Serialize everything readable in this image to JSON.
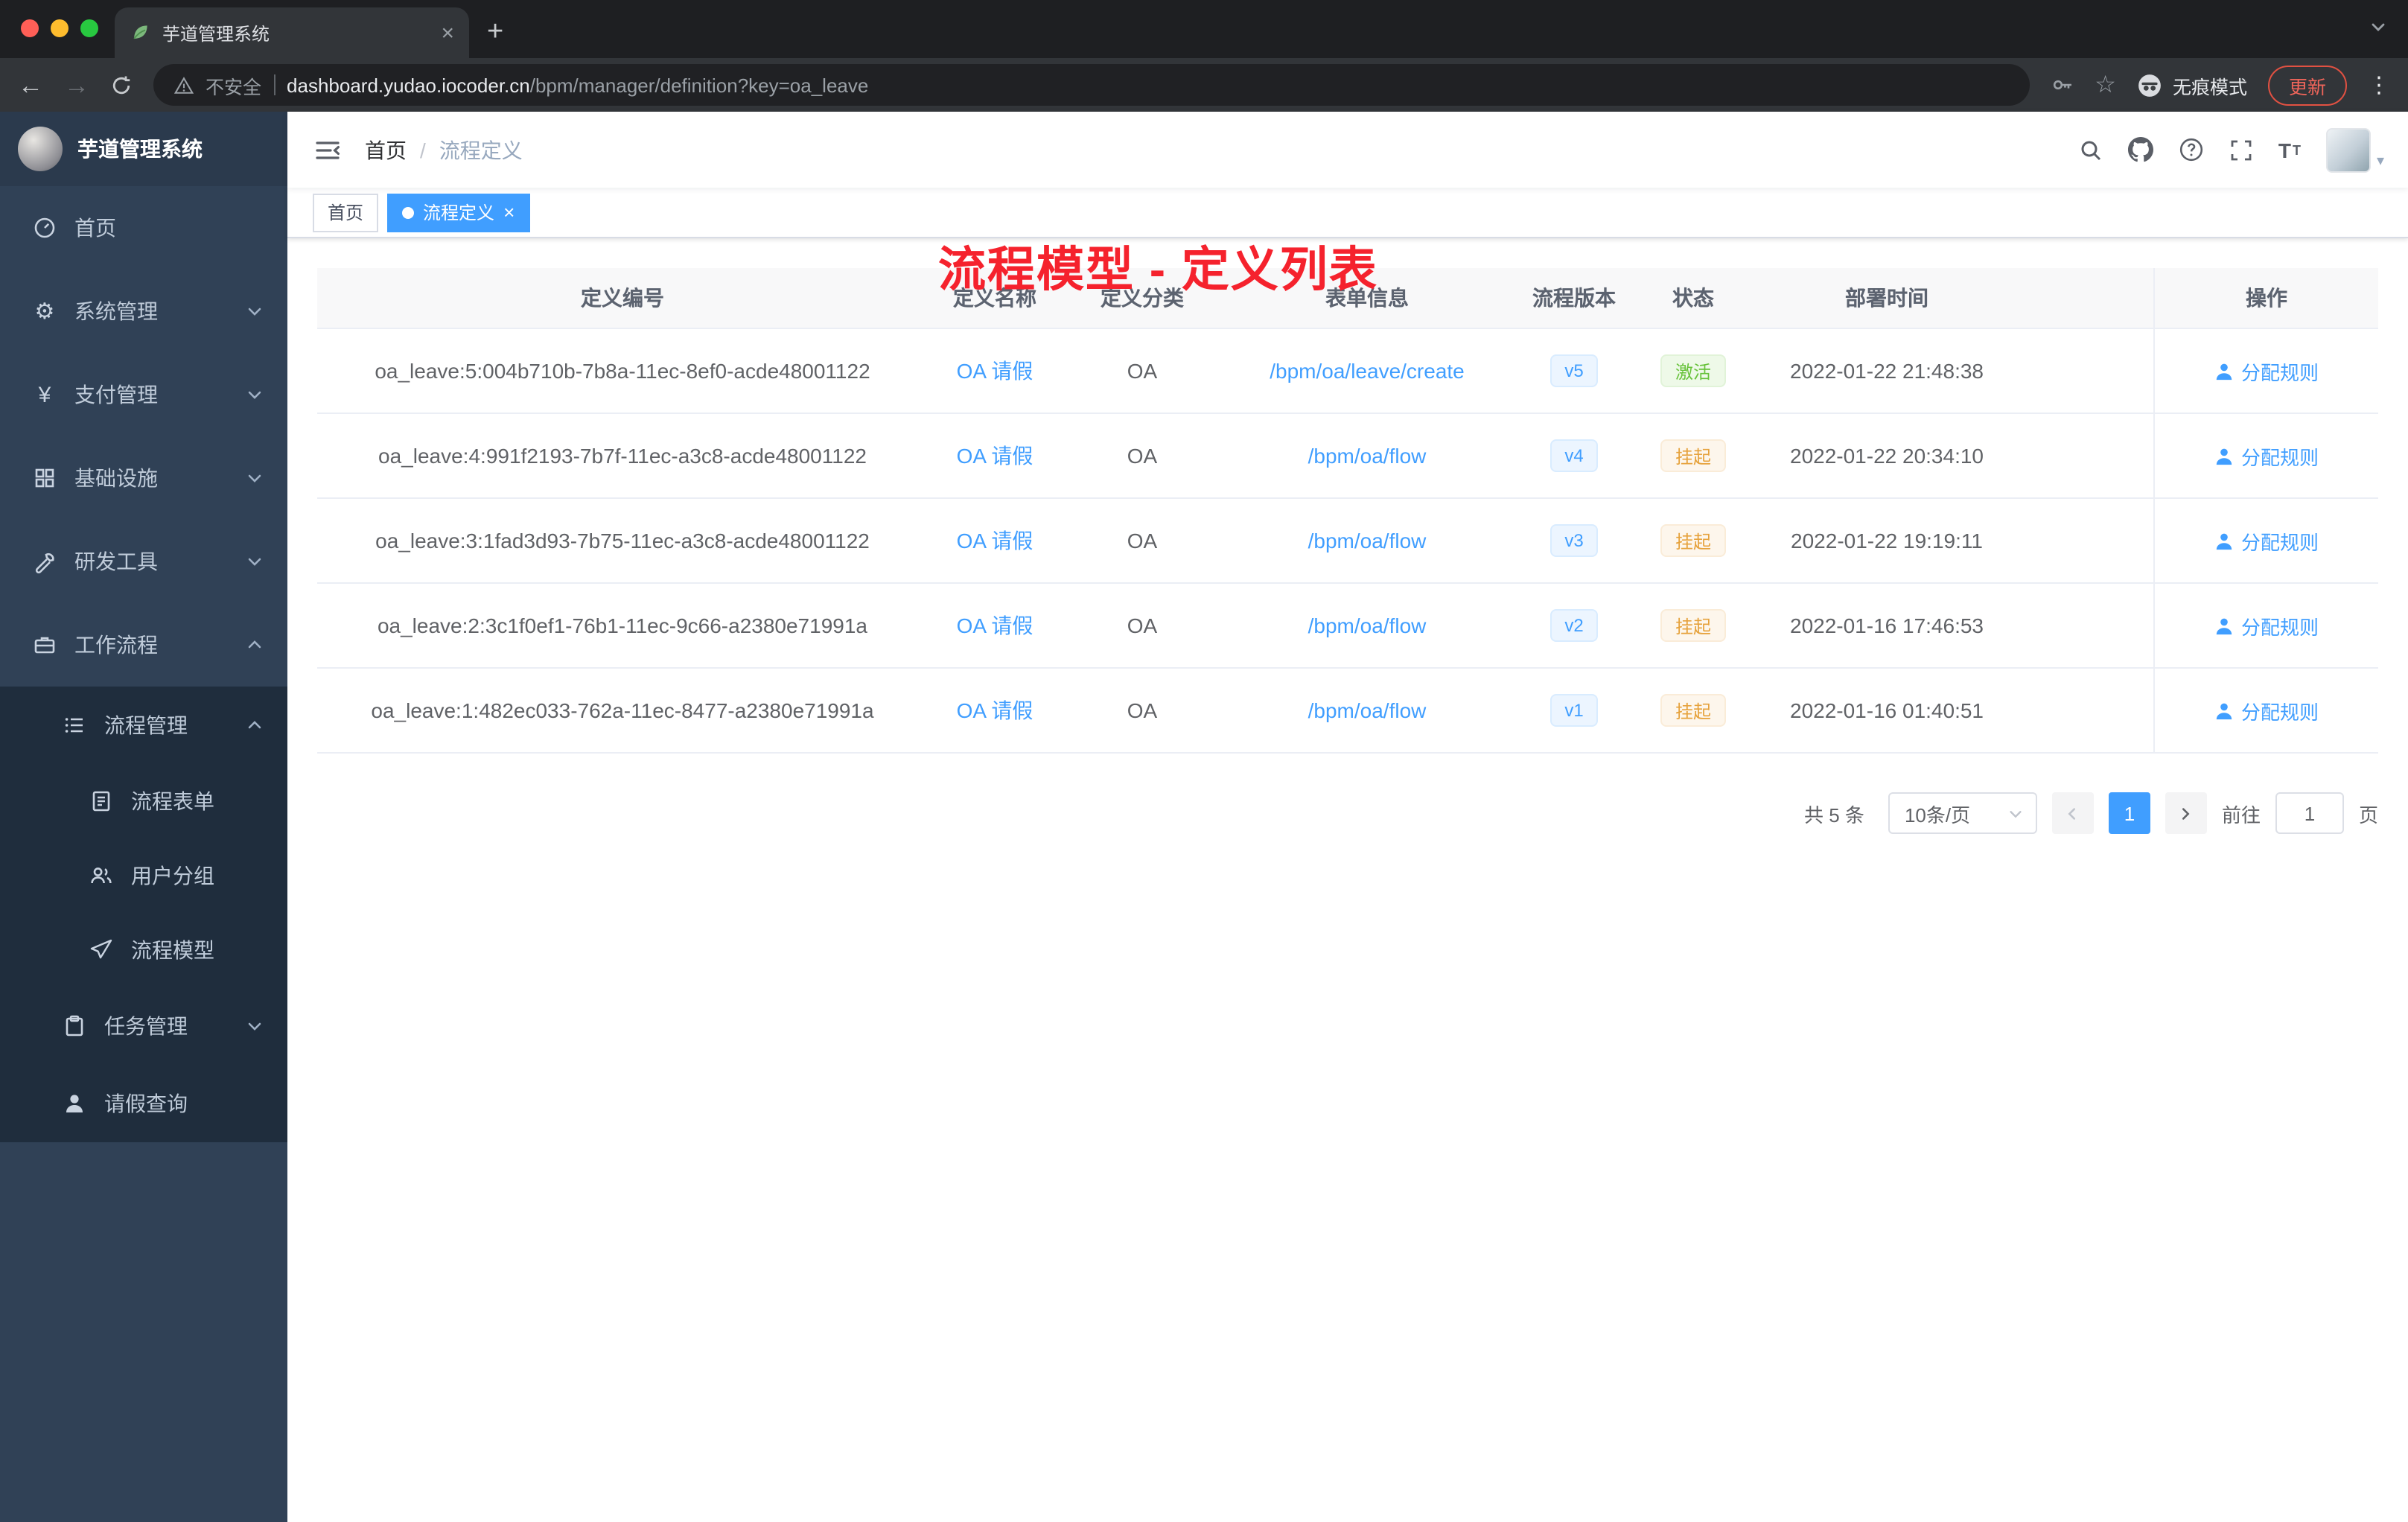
{
  "colors": {
    "accent": "#409eff",
    "success": "#67c23a",
    "warning": "#e6a23c",
    "annotation_red": "#f5222d",
    "sidebar_bg": "#304156",
    "submenu_bg": "#1f2d3d"
  },
  "icons": {
    "close": "×",
    "plus": "+",
    "back": "←",
    "forward": "→",
    "star": "☆",
    "more_vertical": "⋮",
    "caret_down": "▾",
    "gear": "⚙",
    "yen": "¥",
    "font_size_big": "T",
    "font_size_small": "T"
  },
  "browser": {
    "tab_title": "芋道管理系统",
    "not_secure": "不安全",
    "url_host": "dashboard.yudao.iocoder.cn",
    "url_path": "/bpm/manager/definition?key=oa_leave",
    "incognito_label": "无痕模式",
    "update_label": "更新"
  },
  "sidebar": {
    "logo_title": "芋道管理系统",
    "items": [
      {
        "label": "首页"
      },
      {
        "label": "系统管理"
      },
      {
        "label": "支付管理"
      },
      {
        "label": "基础设施"
      },
      {
        "label": "研发工具"
      },
      {
        "label": "工作流程"
      },
      {
        "label": "流程管理"
      },
      {
        "label": "流程表单"
      },
      {
        "label": "用户分组"
      },
      {
        "label": "流程模型"
      },
      {
        "label": "任务管理"
      },
      {
        "label": "请假查询"
      }
    ]
  },
  "header": {
    "breadcrumb_home": "首页",
    "breadcrumb_sep": "/",
    "breadcrumb_current": "流程定义",
    "annotation": "流程模型 - 定义列表"
  },
  "tags": {
    "home": "首页",
    "active": "流程定义"
  },
  "table": {
    "columns": [
      "定义编号",
      "定义名称",
      "定义分类",
      "表单信息",
      "流程版本",
      "状态",
      "部署时间",
      "操作"
    ],
    "rows": [
      {
        "id": "oa_leave:5:004b710b-7b8a-11ec-8ef0-acde48001122",
        "name": "OA 请假",
        "category": "OA",
        "form": "/bpm/oa/leave/create",
        "version": "v5",
        "status": "激活",
        "time": "2022-01-22 21:48:38",
        "action": "分配规则"
      },
      {
        "id": "oa_leave:4:991f2193-7b7f-11ec-a3c8-acde48001122",
        "name": "OA 请假",
        "category": "OA",
        "form": "/bpm/oa/flow",
        "version": "v4",
        "status": "挂起",
        "time": "2022-01-22 20:34:10",
        "action": "分配规则"
      },
      {
        "id": "oa_leave:3:1fad3d93-7b75-11ec-a3c8-acde48001122",
        "name": "OA 请假",
        "category": "OA",
        "form": "/bpm/oa/flow",
        "version": "v3",
        "status": "挂起",
        "time": "2022-01-22 19:19:11",
        "action": "分配规则"
      },
      {
        "id": "oa_leave:2:3c1f0ef1-76b1-11ec-9c66-a2380e71991a",
        "name": "OA 请假",
        "category": "OA",
        "form": "/bpm/oa/flow",
        "version": "v2",
        "status": "挂起",
        "time": "2022-01-16 17:46:53",
        "action": "分配规则"
      },
      {
        "id": "oa_leave:1:482ec033-762a-11ec-8477-a2380e71991a",
        "name": "OA 请假",
        "category": "OA",
        "form": "/bpm/oa/flow",
        "version": "v1",
        "status": "挂起",
        "time": "2022-01-16 01:40:51",
        "action": "分配规则"
      }
    ]
  },
  "pagination": {
    "total": "共 5 条",
    "page_size": "10条/页",
    "current_page": "1",
    "goto_label": "前往",
    "goto_value": "1",
    "page_unit": "页"
  }
}
